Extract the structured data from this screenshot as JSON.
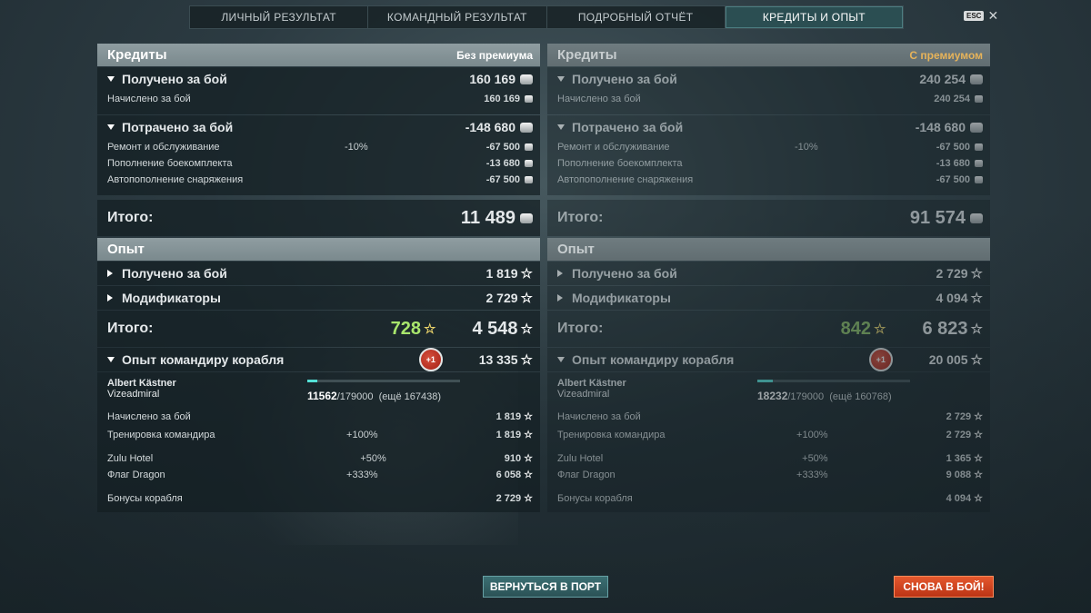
{
  "tabs": [
    "ЛИЧНЫЙ РЕЗУЛЬТАТ",
    "КОМАНДНЫЙ РЕЗУЛЬТАТ",
    "ПОДРОБНЫЙ ОТЧЁТ",
    "КРЕДИТЫ И ОПЫТ"
  ],
  "active_tab": 3,
  "esc_label": "ESC",
  "close_glyph": "✕",
  "left": {
    "credits_title": "Кредиты",
    "account_type": "Без премиума",
    "earned_label": "Получено за бой",
    "earned_value": "160 169",
    "accrued_label": "Начислено за бой",
    "accrued_value": "160 169",
    "spent_label": "Потрачено за бой",
    "spent_value": "-148 680",
    "repair_label": "Ремонт и обслуживание",
    "repair_pct": "-10%",
    "repair_value": "-67 500",
    "ammo_label": "Пополнение боекомплекта",
    "ammo_value": "-13 680",
    "consum_label": "Автопополнение снаряжения",
    "consum_value": "-67 500",
    "total_label": "Итого:",
    "total_value": "11 489",
    "xp_title": "Опыт",
    "xp_earned_label": "Получено за бой",
    "xp_earned_value": "1 819",
    "mods_label": "Модификаторы",
    "mods_value": "2 729",
    "xp_total_label": "Итого:",
    "xp_free": "728",
    "xp_total_value": "4 548",
    "cmdr_xp_label": "Опыт командиру корабля",
    "cmdr_badge": "+1",
    "cmdr_xp_value": "13 335",
    "cmdr_name": "Albert Kästner",
    "cmdr_rank": "Vizeadmiral",
    "cmdr_progress_cur": "11562",
    "cmdr_progress_max": "/179000",
    "cmdr_progress_rest": "(ещё 167438)",
    "cmdr_progress_fraction": 0.065,
    "cmdr_accrued_label": "Начислено за бой",
    "cmdr_accrued_value": "1 819",
    "training_label": "Тренировка командира",
    "training_pct": "+100%",
    "training_value": "1 819",
    "zulu_label": "Zulu Hotel",
    "zulu_pct": "+50%",
    "zulu_value": "910",
    "dragon_label": "Флаг Dragon",
    "dragon_pct": "+333%",
    "dragon_value": "6 058",
    "ship_bonus_label": "Бонусы корабля",
    "ship_bonus_value": "2 729"
  },
  "right": {
    "credits_title": "Кредиты",
    "account_type": "С премиумом",
    "earned_label": "Получено за бой",
    "earned_value": "240 254",
    "accrued_label": "Начислено за бой",
    "accrued_value": "240 254",
    "spent_label": "Потрачено за бой",
    "spent_value": "-148 680",
    "repair_label": "Ремонт и обслуживание",
    "repair_pct": "-10%",
    "repair_value": "-67 500",
    "ammo_label": "Пополнение боекомплекта",
    "ammo_value": "-13 680",
    "consum_label": "Автопополнение снаряжения",
    "consum_value": "-67 500",
    "total_label": "Итого:",
    "total_value": "91 574",
    "xp_title": "Опыт",
    "xp_earned_label": "Получено за бой",
    "xp_earned_value": "2 729",
    "mods_label": "Модификаторы",
    "mods_value": "4 094",
    "xp_total_label": "Итого:",
    "xp_free": "842",
    "xp_total_value": "6 823",
    "cmdr_xp_label": "Опыт командиру корабля",
    "cmdr_badge": "+1",
    "cmdr_xp_value": "20 005",
    "cmdr_name": "Albert Kästner",
    "cmdr_rank": "Vizeadmiral",
    "cmdr_progress_cur": "18232",
    "cmdr_progress_max": "/179000",
    "cmdr_progress_rest": "(ещё 160768)",
    "cmdr_progress_fraction": 0.1,
    "cmdr_accrued_label": "Начислено за бой",
    "cmdr_accrued_value": "2 729",
    "training_label": "Тренировка командира",
    "training_pct": "+100%",
    "training_value": "2 729",
    "zulu_label": "Zulu Hotel",
    "zulu_pct": "+50%",
    "zulu_value": "1 365",
    "dragon_label": "Флаг Dragon",
    "dragon_pct": "+333%",
    "dragon_value": "9 088",
    "ship_bonus_label": "Бонусы корабля",
    "ship_bonus_value": "4 094"
  },
  "buttons": {
    "return_port": "ВЕРНУТЬСЯ В ПОРТ",
    "to_battle": "СНОВА В БОЙ!"
  },
  "icons": {
    "credits": "credit-coin-icon",
    "xp": "xp-star-icon"
  },
  "colors": {
    "premium_label": "#e6b35a",
    "free_xp": "#a8e56c",
    "battle_button": "#d8461f",
    "progress": "#54e0d6"
  }
}
